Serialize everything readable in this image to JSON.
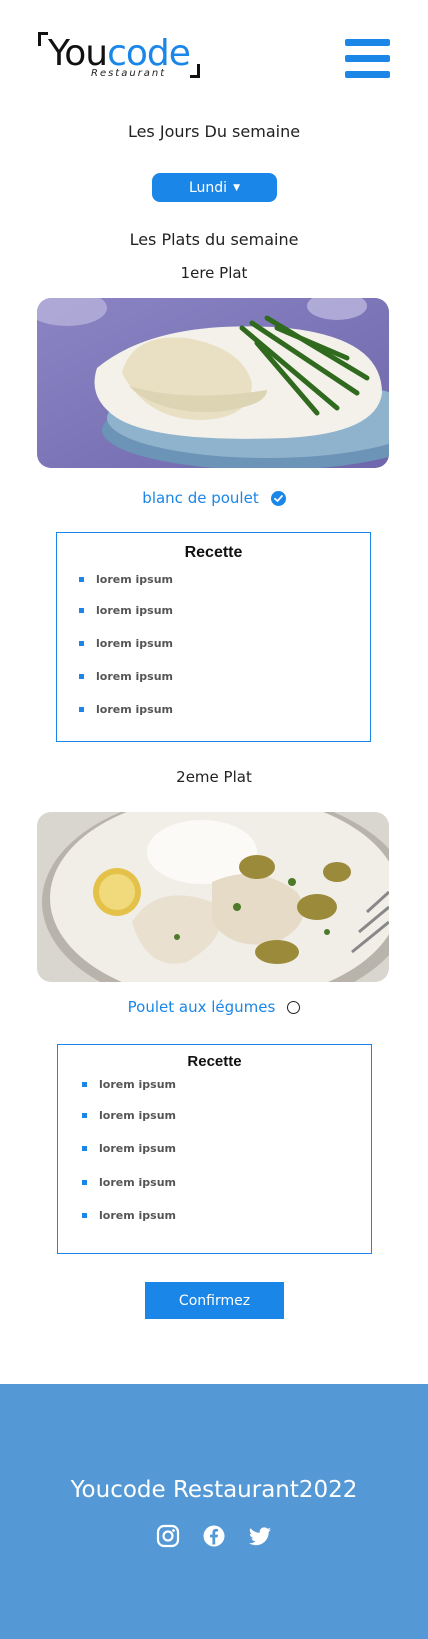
{
  "header": {
    "logo": {
      "word_part1": "You",
      "word_part2": "code",
      "subtitle": "Restaurant"
    },
    "menu_icon": "hamburger-icon"
  },
  "week": {
    "days_title": "Les Jours Du semaine",
    "selected_day": "Lundi",
    "dishes_title": "Les Plats du semaine"
  },
  "dishes": [
    {
      "heading": "1ere Plat",
      "name": "blanc de poulet",
      "selected": true,
      "recipe": {
        "title": "Recette",
        "items": [
          "lorem ipsum",
          "lorem ipsum",
          "lorem ipsum",
          "lorem ipsum",
          "lorem ipsum"
        ]
      }
    },
    {
      "heading": "2eme Plat",
      "name": "Poulet aux légumes",
      "selected": false,
      "recipe": {
        "title": "Recette",
        "items": [
          "lorem ipsum",
          "lorem ipsum",
          "lorem ipsum",
          "lorem ipsum",
          "lorem ipsum"
        ]
      }
    }
  ],
  "confirm_label": "Confirmez",
  "footer": {
    "title": "Youcode Restaurant2022",
    "social_icons": [
      "instagram-icon",
      "facebook-icon",
      "twitter-icon"
    ]
  },
  "colors": {
    "accent": "#1a86e8",
    "footer_bg": "#5499d6"
  }
}
